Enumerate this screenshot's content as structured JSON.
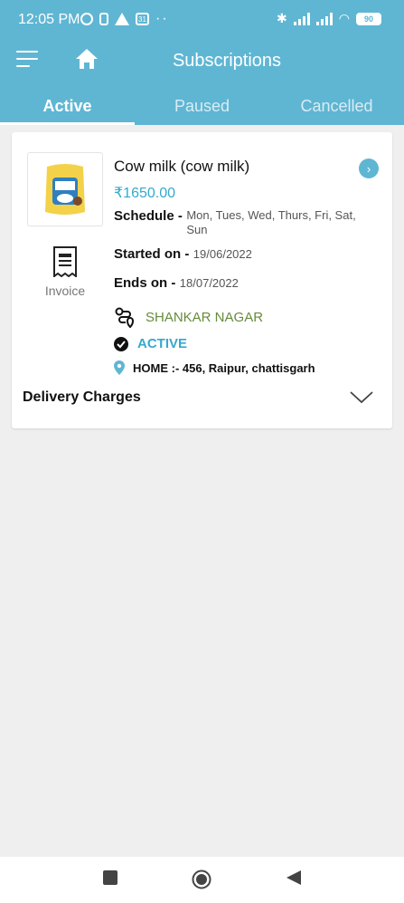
{
  "status_bar": {
    "time": "12:05 PM",
    "battery": "90",
    "calendar_day": "31"
  },
  "app": {
    "title": "Subscriptions"
  },
  "tabs": [
    {
      "label": "Active",
      "active": true
    },
    {
      "label": "Paused",
      "active": false
    },
    {
      "label": "Cancelled",
      "active": false
    }
  ],
  "subscription": {
    "product_name": "Cow milk (cow milk)",
    "price": "₹1650.00",
    "invoice_label": "Invoice",
    "schedule_label": "Schedule -",
    "schedule_value": "Mon, Tues, Wed, Thurs, Fri, Sat, Sun",
    "started_label": "Started on -",
    "started_value": "19/06/2022",
    "ends_label": "Ends on -",
    "ends_value": "18/07/2022",
    "area": "SHANKAR NAGAR",
    "status": "ACTIVE",
    "address": "HOME :- 456, Raipur, chattisgarh",
    "delivery_charges_label": "Delivery Charges"
  },
  "icons": {
    "menu": "menu-icon",
    "home": "home-icon",
    "invoice": "invoice-icon",
    "route": "route-icon",
    "check": "check-circle-icon",
    "location": "location-pin-icon",
    "chevron": "chevron-down-icon",
    "arrow": "chevron-right-icon"
  },
  "colors": {
    "primary": "#5fb6d3",
    "price": "#35a9cf",
    "area": "#668b3c",
    "background": "#efefef"
  }
}
